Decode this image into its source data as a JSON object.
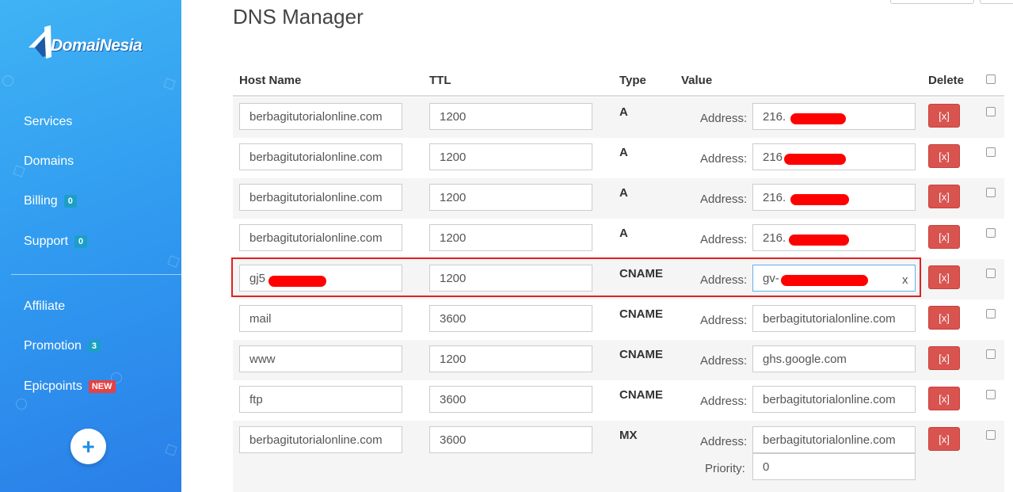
{
  "sidebar": {
    "logo_text": "DomaiNesia",
    "items": [
      {
        "label": "Services"
      },
      {
        "label": "Domains"
      },
      {
        "label": "Billing",
        "badge": "0"
      },
      {
        "label": "Support",
        "badge": "0"
      },
      {
        "label": "Affiliate"
      },
      {
        "label": "Promotion",
        "badge": "3"
      },
      {
        "label": "Epicpoints",
        "badge": "NEW"
      }
    ],
    "add_button": "+"
  },
  "page": {
    "title": "DNS Manager"
  },
  "table": {
    "headers": {
      "host": "Host Name",
      "ttl": "TTL",
      "type": "Type",
      "value": "Value",
      "delete": "Delete"
    },
    "address_label": "Address:",
    "priority_label": "Priority:",
    "delete_label": "[x]",
    "rows": [
      {
        "host": "berbagitutorialonline.com",
        "ttl": "1200",
        "type": "A",
        "address": "216."
      },
      {
        "host": "berbagitutorialonline.com",
        "ttl": "1200",
        "type": "A",
        "address": "216"
      },
      {
        "host": "berbagitutorialonline.com",
        "ttl": "1200",
        "type": "A",
        "address": "216."
      },
      {
        "host": "berbagitutorialonline.com",
        "ttl": "1200",
        "type": "A",
        "address": "216."
      },
      {
        "host": "gj5",
        "ttl": "1200",
        "type": "CNAME",
        "address": "gv-",
        "address_tail": "x"
      },
      {
        "host": "mail",
        "ttl": "3600",
        "type": "CNAME",
        "address": "berbagitutorialonline.com"
      },
      {
        "host": "www",
        "ttl": "1200",
        "type": "CNAME",
        "address": "ghs.google.com"
      },
      {
        "host": "ftp",
        "ttl": "3600",
        "type": "CNAME",
        "address": "berbagitutorialonline.com"
      },
      {
        "host": "berbagitutorialonline.com",
        "ttl": "3600",
        "type": "MX",
        "address": "berbagitutorialonline.com",
        "priority": "0"
      }
    ]
  },
  "colors": {
    "sidebar": "#2f97ef",
    "delete_button": "#d9534f",
    "highlight": "#e02020",
    "redaction": "#ff0000"
  }
}
